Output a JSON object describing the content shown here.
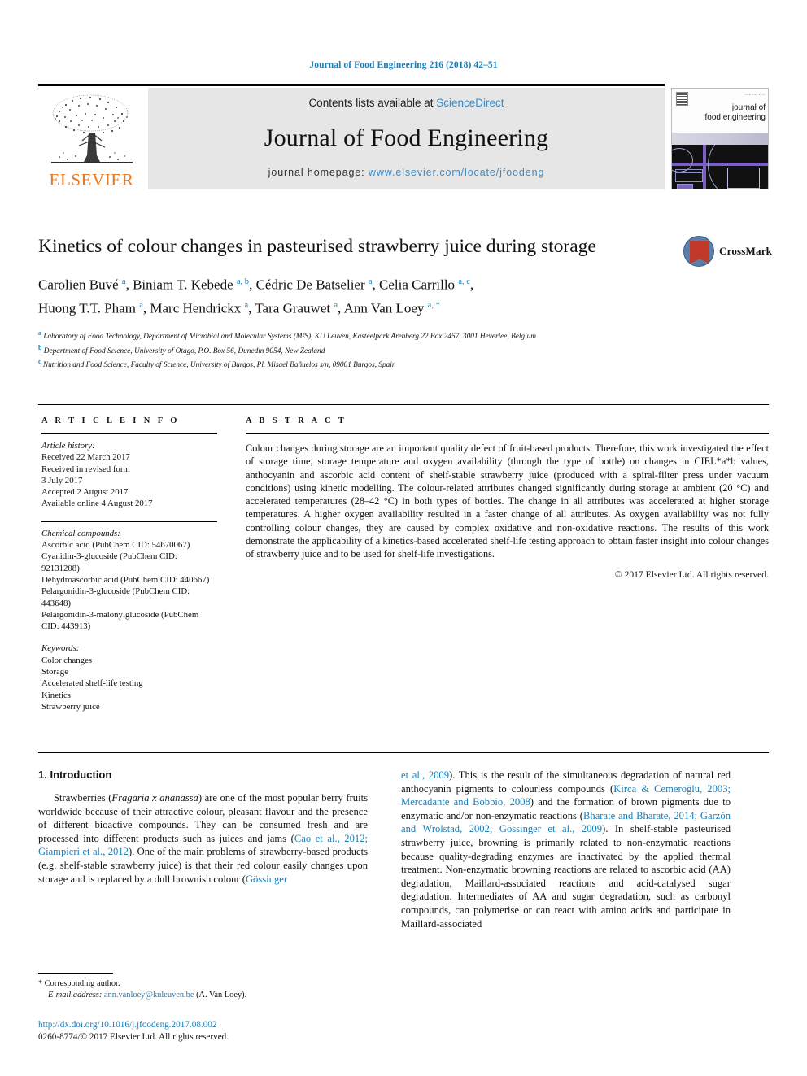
{
  "running_head": "Journal of Food Engineering 216 (2018) 42–51",
  "masthead": {
    "contents_prefix": "Contents lists available at ",
    "sciencedirect": "ScienceDirect",
    "journal_title": "Journal of Food Engineering",
    "homepage_prefix": "journal homepage: ",
    "homepage_url": "www.elsevier.com/locate/jfoodeng",
    "publisher": "ELSEVIER",
    "cover_title_line1": "journal of",
    "cover_title_line2": "food engineering",
    "accent_blue": "#3a8cc8",
    "elsevier_orange": "#e87722"
  },
  "article": {
    "title": "Kinetics of colour changes in pasteurised strawberry juice during storage",
    "authors_line1": "Carolien Buvé ª, Biniam T. Kebede ª, ᵇ, Cédric De Batselier ª, Celia Carrillo ª, ᶜ,",
    "authors_line2": "Huong T.T. Pham ª, Marc Hendrickx ª, Tara Grauwet ª, Ann Van Loey ª, *",
    "authors": [
      {
        "name": "Carolien Buvé",
        "sup": "a"
      },
      {
        "name": "Biniam T. Kebede",
        "sup": "a, b"
      },
      {
        "name": "Cédric De Batselier",
        "sup": "a"
      },
      {
        "name": "Celia Carrillo",
        "sup": "a, c"
      },
      {
        "name": "Huong T.T. Pham",
        "sup": "a"
      },
      {
        "name": "Marc Hendrickx",
        "sup": "a"
      },
      {
        "name": "Tara Grauwet",
        "sup": "a"
      },
      {
        "name": "Ann Van Loey",
        "sup": "a, *"
      }
    ],
    "affiliations": [
      {
        "sup": "a",
        "text": "Laboratory of Food Technology, Department of Microbial and Molecular Systems (M²S), KU Leuven, Kasteelpark Arenberg 22 Box 2457, 3001 Heverlee, Belgium"
      },
      {
        "sup": "b",
        "text": "Department of Food Science, University of Otago, P.O. Box 56, Dunedin 9054, New Zealand"
      },
      {
        "sup": "c",
        "text": "Nutrition and Food Science, Faculty of Science, University of Burgos, Pl. Misael Bañuelos s/n, 09001 Burgos, Spain"
      }
    ],
    "crossmark_label": "CrossMark"
  },
  "article_info": {
    "heading": "A R T I C L E   I N F O",
    "history_label": "Article history:",
    "history": [
      "Received 22 March 2017",
      "Received in revised form",
      "3 July 2017",
      "Accepted 2 August 2017",
      "Available online 4 August 2017"
    ],
    "compounds_label": "Chemical compounds:",
    "compounds": [
      "Ascorbic acid (PubChem CID: 54670067)",
      "Cyanidin-3-glucoside (PubChem CID: 92131208)",
      "Dehydroascorbic acid (PubChem CID: 440667)",
      "Pelargonidin-3-glucoside (PubChem CID: 443648)",
      "Pelargonidin-3-malonylglucoside (PubChem CID: 443913)"
    ],
    "keywords_label": "Keywords:",
    "keywords": [
      "Color changes",
      "Storage",
      "Accelerated shelf-life testing",
      "Kinetics",
      "Strawberry juice"
    ]
  },
  "abstract": {
    "heading": "A B S T R A C T",
    "text": "Colour changes during storage are an important quality defect of fruit-based products. Therefore, this work investigated the effect of storage time, storage temperature and oxygen availability (through the type of bottle) on changes in CIEL*a*b values, anthocyanin and ascorbic acid content of shelf-stable strawberry juice (produced with a spiral-filter press under vacuum conditions) using kinetic modelling. The colour-related attributes changed significantly during storage at ambient (20 °C) and accelerated temperatures (28–42 °C) in both types of bottles. The change in all attributes was accelerated at higher storage temperatures. A higher oxygen availability resulted in a faster change of all attributes. As oxygen availability was not fully controlling colour changes, they are caused by complex oxidative and non-oxidative reactions. The results of this work demonstrate the applicability of a kinetics-based accelerated shelf-life testing approach to obtain faster insight into colour changes of strawberry juice and to be used for shelf-life investigations.",
    "copyright": "© 2017 Elsevier Ltd. All rights reserved."
  },
  "introduction": {
    "section_number_title": "1. Introduction",
    "left_paragraph": "Strawberries (Fragaria x ananassa) are one of the most popular berry fruits worldwide because of their attractive colour, pleasant flavour and the presence of different bioactive compounds. They can be consumed fresh and are processed into different products such as juices and jams (Cao et al., 2012; Giampieri et al., 2012). One of the main problems of strawberry-based products (e.g. shelf-stable strawberry juice) is that their red colour easily changes upon storage and is replaced by a dull brownish colour (Gössinger",
    "right_paragraph": "et al., 2009). This is the result of the simultaneous degradation of natural red anthocyanin pigments to colourless compounds (Kirca & Cemeroğlu, 2003; Mercadante and Bobbio, 2008) and the formation of brown pigments due to enzymatic and/or non-enzymatic reactions (Bharate and Bharate, 2014; Garzón and Wrolstad, 2002; Gössinger et al., 2009). In shelf-stable pasteurised strawberry juice, browning is primarily related to non-enzymatic reactions because quality-degrading enzymes are inactivated by the applied thermal treatment. Non-enzymatic browning reactions are related to ascorbic acid (AA) degradation, Maillard-associated reactions and acid-catalysed sugar degradation. Intermediates of AA and sugar degradation, such as carbonyl compounds, can polymerise or can react with amino acids and participate in Maillard-associated"
  },
  "footnotes": {
    "corresponding_marker": "*",
    "corresponding_text": "Corresponding author.",
    "email_label": "E-mail address:",
    "email": "ann.vanloey@kuleuven.be",
    "email_suffix": "(A. Van Loey)."
  },
  "footer": {
    "doi": "http://dx.doi.org/10.1016/j.jfoodeng.2017.08.002",
    "issn_line": "0260-8774/© 2017 Elsevier Ltd. All rights reserved."
  }
}
